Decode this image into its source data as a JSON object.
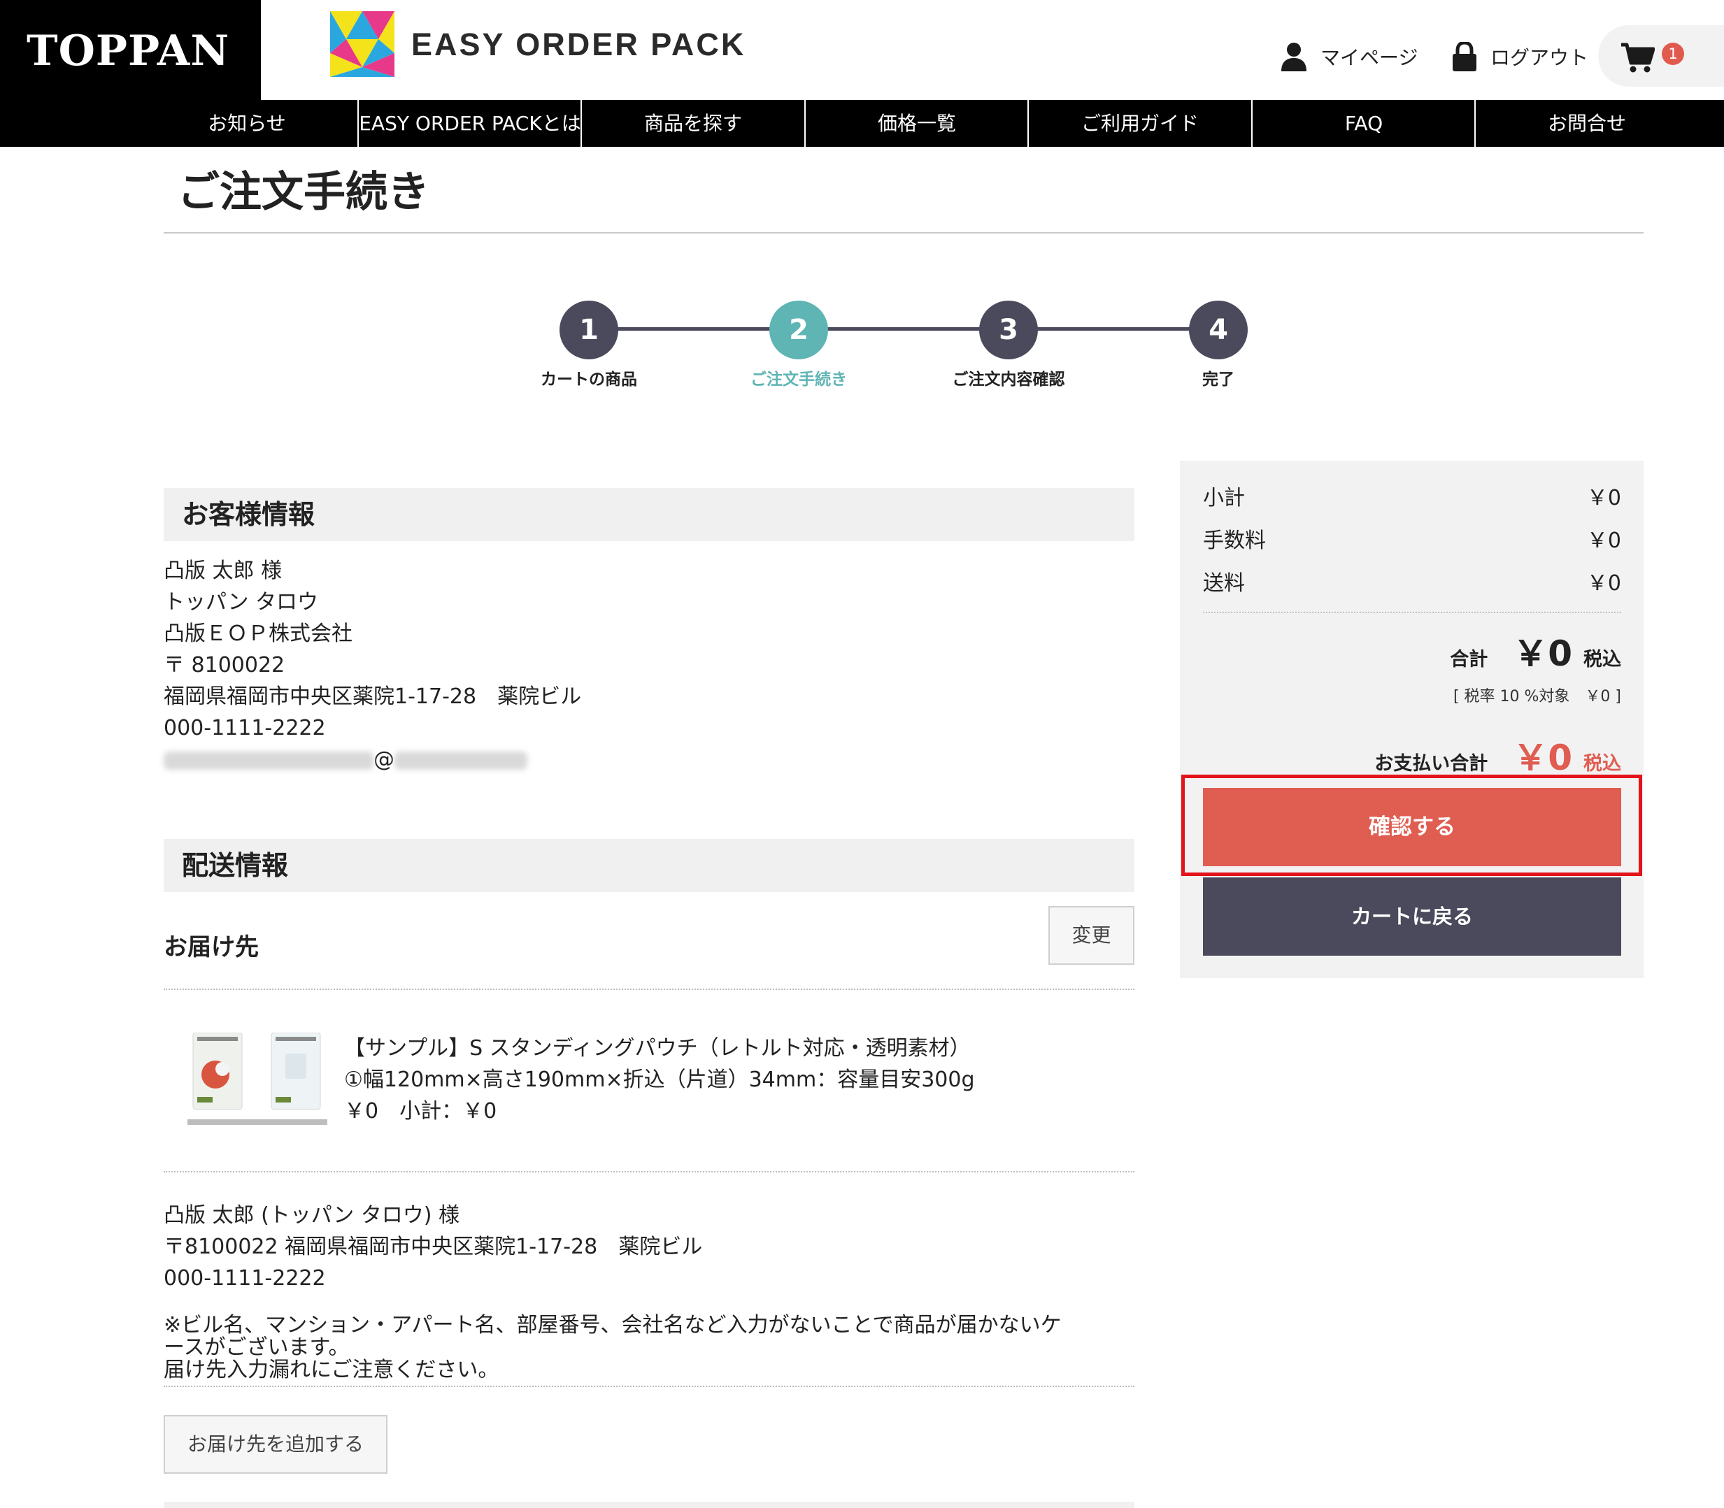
{
  "header": {
    "company_logo": "TOPPAN",
    "brand_name": "EASY ORDER PACK",
    "mypage_label": "マイページ",
    "logout_label": "ログアウト",
    "cart_count": "1"
  },
  "nav": {
    "items": [
      {
        "label": "お知らせ"
      },
      {
        "label": "EASY ORDER PACKとは"
      },
      {
        "label": "商品を探す"
      },
      {
        "label": "価格一覧"
      },
      {
        "label": "ご利用ガイド"
      },
      {
        "label": "FAQ"
      },
      {
        "label": "お問合せ"
      }
    ]
  },
  "page": {
    "title": "ご注文手続き"
  },
  "stepper": {
    "steps": [
      {
        "number": "1",
        "label": "カートの商品"
      },
      {
        "number": "2",
        "label": "ご注文手続き"
      },
      {
        "number": "3",
        "label": "ご注文内容確認"
      },
      {
        "number": "4",
        "label": "完了"
      }
    ],
    "active_step": 2
  },
  "customer": {
    "heading": "お客様情報",
    "name": "凸版 太郎 様",
    "kana": "トッパン タロウ",
    "company": "凸版ＥＯＰ株式会社",
    "postal": "〒 8100022",
    "address": "福岡県福岡市中央区薬院1-17-28　薬院ビル",
    "phone": "000-1111-2222",
    "email_at": "@"
  },
  "shipping": {
    "heading": "配送情報",
    "destination_label": "お届け先",
    "change_label": "変更",
    "product": {
      "name": "【サンプル】S スタンディングパウチ（レトルト対応・透明素材）",
      "spec": "①幅120mm×高さ190mm×折込（片道）34mm：容量目安300g",
      "price_line": "￥0　小計：￥0"
    },
    "recipient": "凸版 太郎 (トッパン タロウ) 様",
    "recipient_address": "〒8100022 福岡県福岡市中央区薬院1-17-28　薬院ビル",
    "recipient_phone": "000-1111-2222",
    "notice_line1": "※ビル名、マンション・アパート名、部屋番号、会社名など入力がないことで商品が届かないケ",
    "notice_line2": "ースがございます。",
    "notice_line3": "届け先入力漏れにご注意ください。",
    "add_destination_label": "お届け先を追加する"
  },
  "summary": {
    "subtotal_label": "小計",
    "subtotal_value": "￥0",
    "fee_label": "手数料",
    "fee_value": "￥0",
    "shipping_label": "送料",
    "shipping_value": "￥0",
    "total_label": "合計",
    "total_value": "￥0",
    "tax_included": "税込",
    "tax_note": "[ 税率 10 %対象　￥0 ]",
    "payment_label": "お支払い合計",
    "payment_value": "￥0",
    "payment_tax": "税込",
    "confirm_label": "確認する",
    "back_label": "カートに戻る"
  },
  "colors": {
    "accent_teal": "#5fb4b4",
    "step_dark": "#4a4a5c",
    "confirm_red": "#e05d51",
    "highlight_red": "#e3131b"
  }
}
